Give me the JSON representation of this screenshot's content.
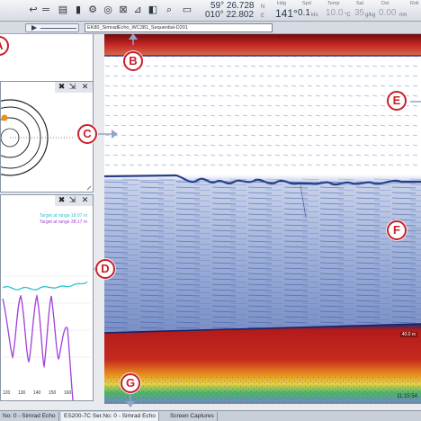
{
  "toolbar": {
    "icons": [
      "back-arrow-icon",
      "ruler-icon",
      "bar-chart-icon",
      "settings-icon",
      "zoom-icon",
      "search-icon",
      "record-icon"
    ]
  },
  "nav": {
    "lat": "59° 26.728",
    "lat_hem": "N",
    "lon": "010° 22.802",
    "lon_hem": "E",
    "hdg_label": "Hdg",
    "hdg_value": "141°",
    "spd_label": "Spd",
    "spd_value": "0.1",
    "spd_unit": "kts",
    "temp_label": "Temp",
    "temp_value": "10.0",
    "temp_unit": "°C",
    "sal_label": "Sal",
    "sal_value": "35",
    "sal_unit": "g/kg",
    "dst_label": "Dst",
    "dst_value": "0.00",
    "dst_unit": "nm",
    "roll_label": "Roll"
  },
  "filebar": {
    "filename": "EK80_SimradEcho_WC381_Sequential-D201"
  },
  "spectrum": {
    "legend_a": "Target at range 18.07 m",
    "legend_b": "Target at range 38.17 m",
    "xticks": [
      "120",
      "130",
      "140",
      "150",
      "160"
    ],
    "colors": {
      "a": "#2cc5cf",
      "b": "#a23fd9"
    }
  },
  "echogram": {
    "depth_readout": "40.0 m",
    "clock": "11:15:54"
  },
  "callouts": [
    "A",
    "B",
    "C",
    "D",
    "E",
    "F",
    "G"
  ],
  "tabs": [
    "No: 0 - Simrad Echo",
    "ES200-7C Ser.No: 0 - Simrad Echo",
    "Screen Captures"
  ],
  "colors": {
    "callout": "#c8202a",
    "echo_red": "#b01818",
    "echo_blue": "#3a5aa8"
  }
}
